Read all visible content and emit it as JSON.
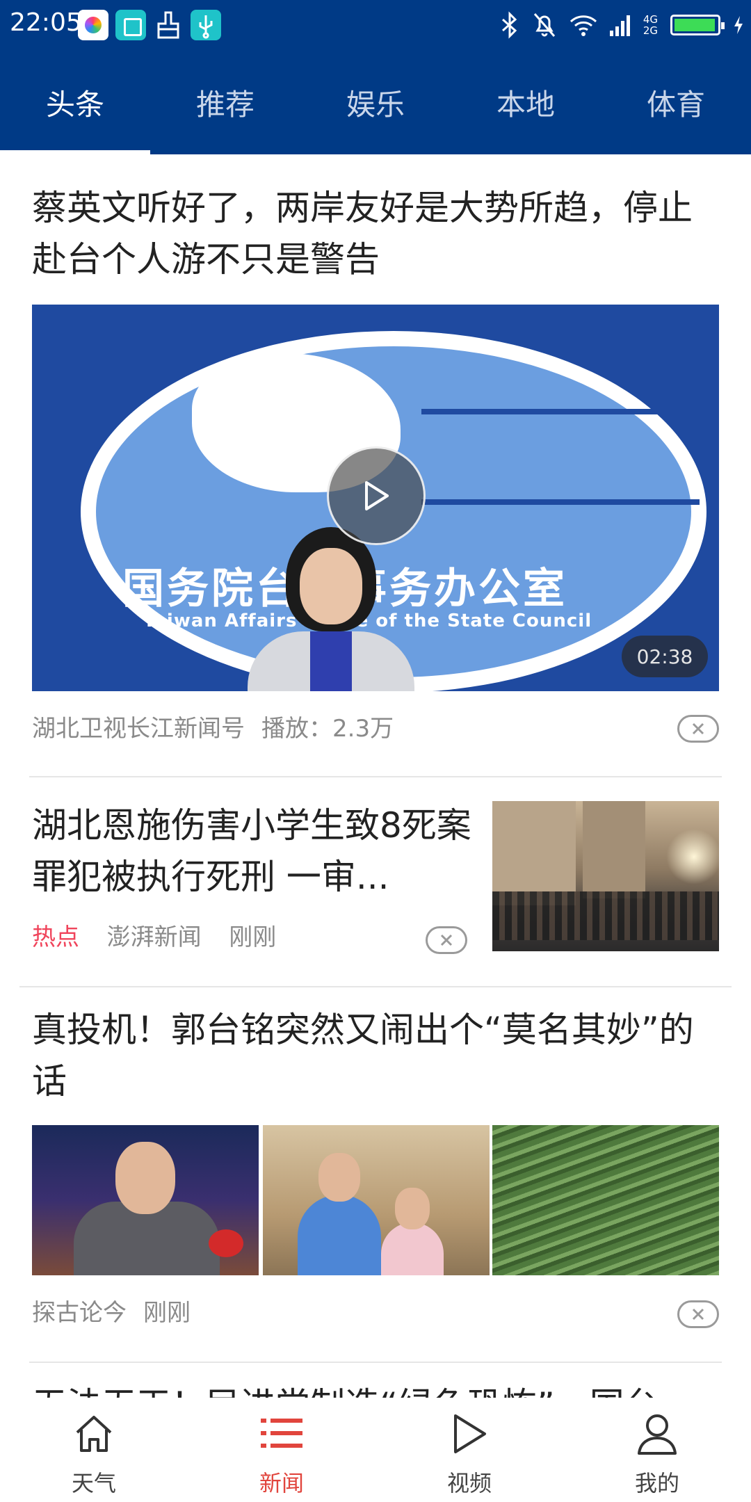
{
  "status_bar": {
    "time": "22:05",
    "network_top": "4G",
    "network_bottom": "2G",
    "icons": [
      "app-icon",
      "scan-icon",
      "cleaner-icon",
      "usb-icon",
      "bluetooth-icon",
      "bell-off-icon",
      "wifi-icon",
      "signal-icon",
      "battery-icon",
      "charging-icon"
    ]
  },
  "tabs": [
    {
      "label": "头条",
      "active": true
    },
    {
      "label": "推荐",
      "active": false
    },
    {
      "label": "娱乐",
      "active": false
    },
    {
      "label": "本地",
      "active": false
    },
    {
      "label": "体育",
      "active": false
    }
  ],
  "feed": {
    "article1": {
      "title": "蔡英文听好了，两岸友好是大势所趋，停止赴台个人游不只是警告",
      "video_banner_cn": "国务院台湾事务办公室",
      "video_banner_en": "Taiwan Affairs Office of the State Council",
      "duration": "02:38",
      "source": "湖北卫视长江新闻号",
      "plays": "播放：2.3万"
    },
    "article2": {
      "title": "湖北恩施伤害小学生致8死案罪犯被执行死刑 一审...",
      "tag": "热点",
      "source": "澎湃新闻",
      "time": "刚刚"
    },
    "article3": {
      "title": "真投机！郭台铭突然又闹出个“莫名其妙”的话",
      "source": "探古论今",
      "time": "刚刚"
    },
    "article4": {
      "title": "无法无天！民进党制造“绿色恐怖”，国台"
    }
  },
  "bottom_nav": [
    {
      "label": "天气",
      "icon": "home-icon",
      "active": false
    },
    {
      "label": "新闻",
      "icon": "list-icon",
      "active": true
    },
    {
      "label": "视频",
      "icon": "play-icon",
      "active": false
    },
    {
      "label": "我的",
      "icon": "user-icon",
      "active": false
    }
  ],
  "colors": {
    "header_bg": "#003a86",
    "active_nav": "#e1453d",
    "hot_tag": "#f0445b"
  }
}
